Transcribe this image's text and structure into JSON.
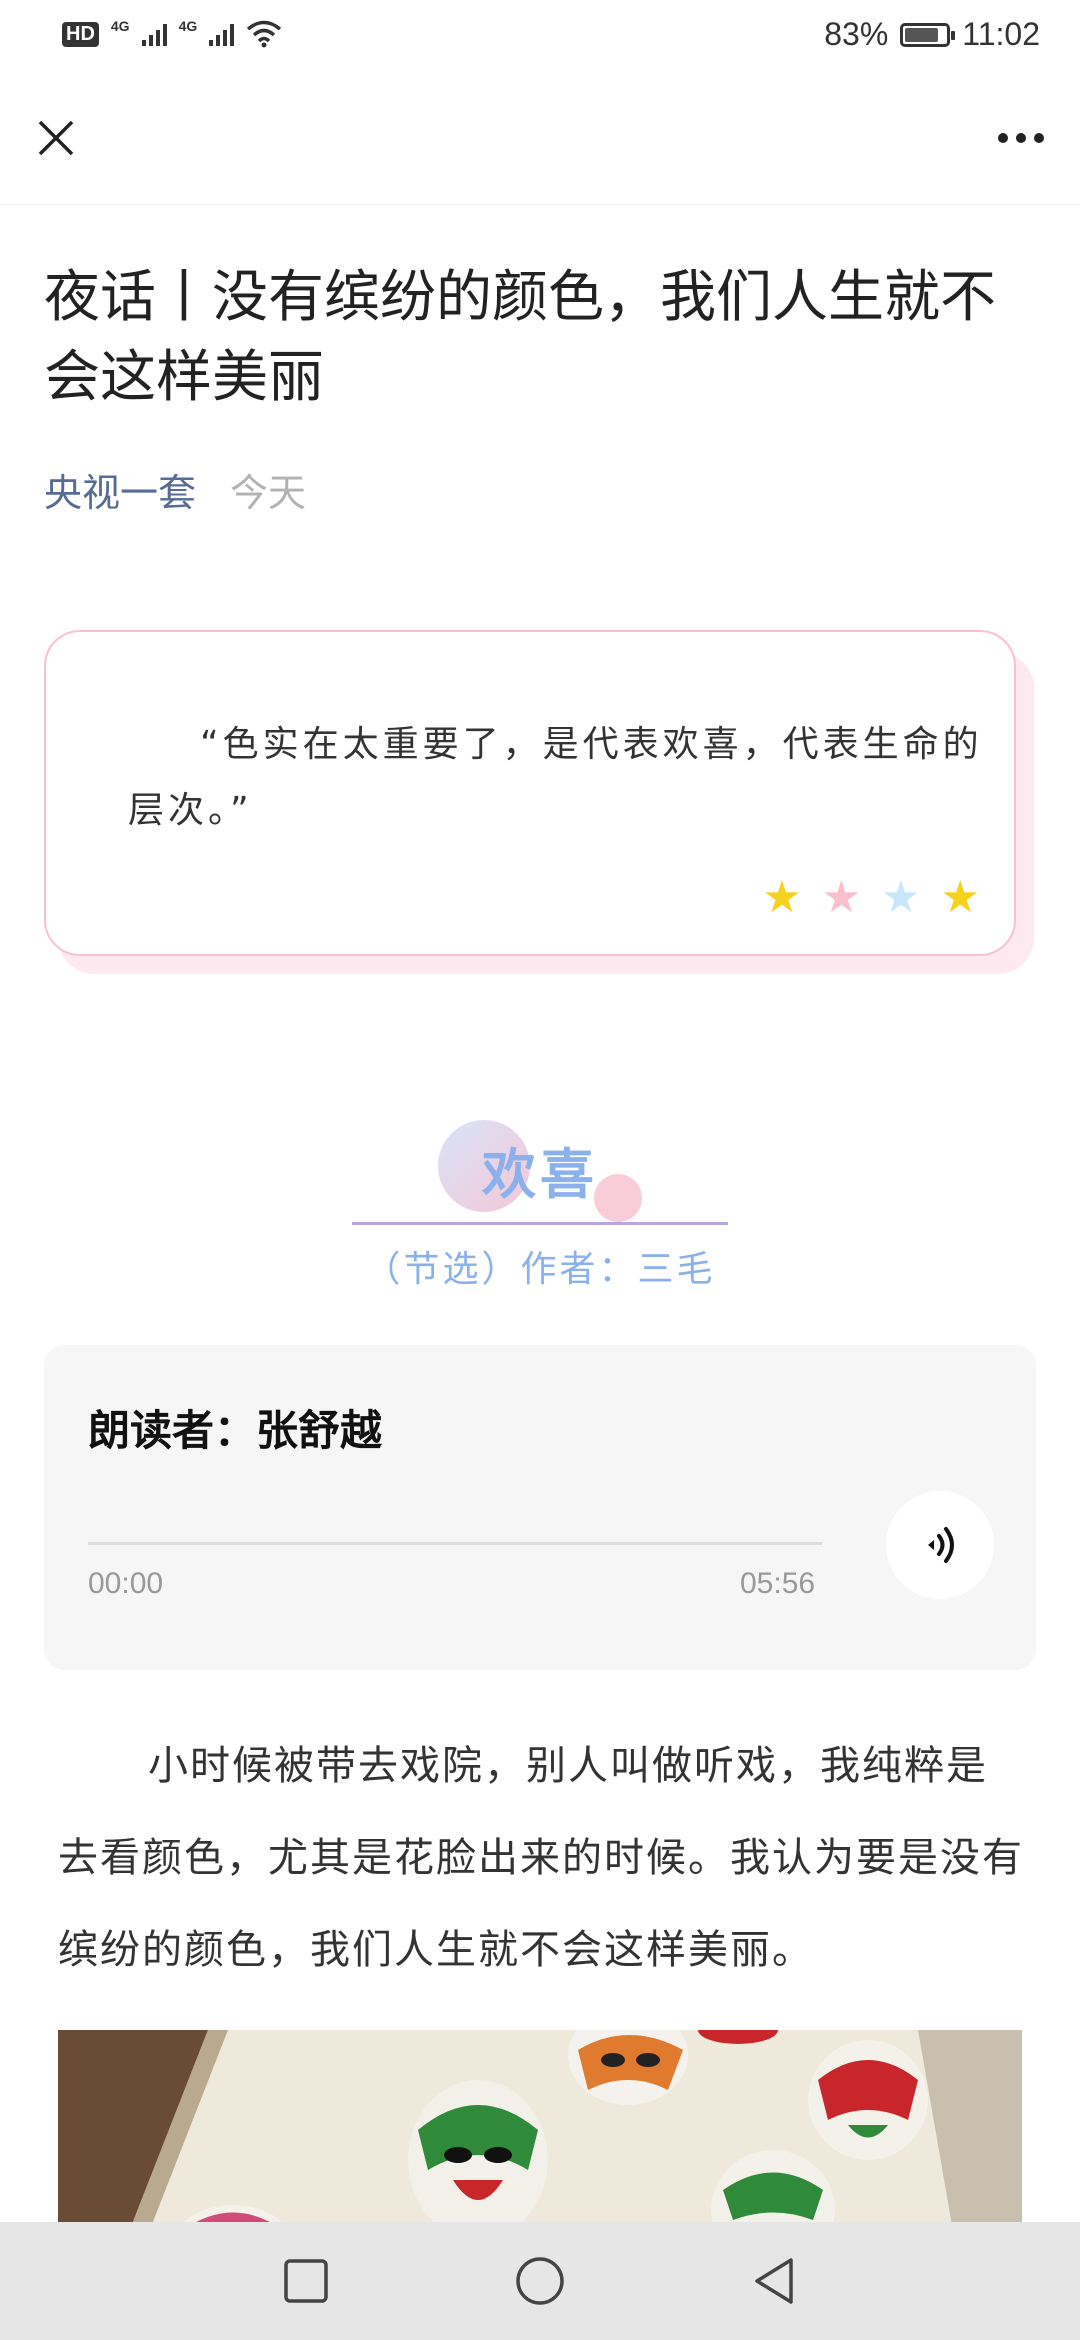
{
  "status_bar": {
    "hd": "HD",
    "net1": "4G",
    "net2": "4G",
    "battery_percent": "83%",
    "battery_level": 0.83,
    "time": "11:02"
  },
  "nav": {
    "close_icon": "close-icon",
    "more_icon": "more-dots-icon"
  },
  "article": {
    "title": "夜话丨没有缤纷的颜色，我们人生就不会这样美丽",
    "source": "央视一套",
    "date": "今天"
  },
  "quote": {
    "text": "“色实在太重要了，是代表欢喜，代表生命的层次。”",
    "stars": [
      {
        "icon": "star-icon",
        "color": "#f7d21c"
      },
      {
        "icon": "star-icon",
        "color": "#f9c0cc"
      },
      {
        "icon": "star-icon",
        "color": "#c9e7fb"
      },
      {
        "icon": "star-icon",
        "color": "#f7d21c"
      }
    ]
  },
  "section": {
    "title": "欢喜",
    "subtitle": "（节选）作者：三毛"
  },
  "audio": {
    "reader": "朗读者：张舒越",
    "current_time": "00:00",
    "total_time": "05:56",
    "progress": 0,
    "play_icon": "audio-wave-icon"
  },
  "body": {
    "paragraph": "小时候被带去戏院，别人叫做听戏，我纯粹是去看颜色，尤其是花脸出来的时候。我认为要是没有缤纷的颜色，我们人生就不会这样美丽。"
  },
  "system_nav": {
    "recent": "square-icon",
    "home": "circle-icon",
    "back": "triangle-back-icon"
  },
  "colors": {
    "source_link": "#576b95",
    "section_title": "#8ab1ec",
    "quote_border": "#f7c2cf"
  }
}
